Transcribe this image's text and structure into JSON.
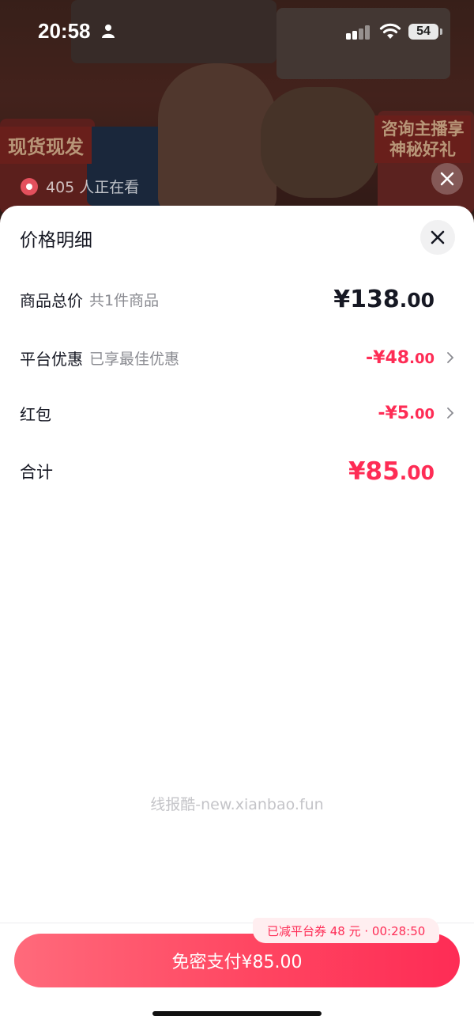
{
  "status_bar": {
    "time": "20:58",
    "battery": "54"
  },
  "background": {
    "banner_left": "现货现发",
    "banner_right": "咨询主播享神秘好礼",
    "viewers": "405 人正在看"
  },
  "sheet": {
    "title": "价格明细",
    "rows": [
      {
        "label": "商品总价",
        "sub": "共1件商品",
        "amount_int": "¥138",
        "amount_dec": ".00"
      },
      {
        "label": "平台优惠",
        "sub": "已享最佳优惠",
        "amount_int": "-¥48",
        "amount_dec": ".00"
      },
      {
        "label": "红包",
        "sub": "",
        "amount_int": "-¥5",
        "amount_dec": ".00"
      },
      {
        "label": "合计",
        "sub": "",
        "amount_int": "¥85",
        "amount_dec": ".00"
      }
    ],
    "watermark": "线报酷-new.xianbao.fun"
  },
  "footer": {
    "coupon_badge": "已减平台券 48 元 · 00:28:50",
    "pay_button": "免密支付¥85.00"
  },
  "colors": {
    "accent": "#fe2c55",
    "text_primary": "#161823",
    "text_secondary": "#8a8b91"
  }
}
